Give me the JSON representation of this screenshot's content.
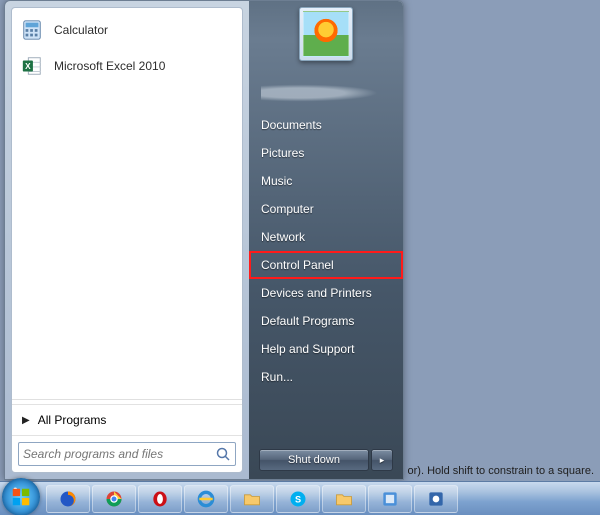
{
  "desktop": {
    "hint_text": "or). Hold shift to constrain to a square."
  },
  "start_menu": {
    "programs": [
      {
        "label": "Calculator",
        "icon": "calculator-icon"
      },
      {
        "label": "Microsoft Excel 2010",
        "icon": "excel-icon"
      }
    ],
    "all_programs_label": "All Programs",
    "search_placeholder": "Search programs and files",
    "right": {
      "user_name": "",
      "items": [
        {
          "label": "Documents",
          "highlighted": false
        },
        {
          "label": "Pictures",
          "highlighted": false
        },
        {
          "label": "Music",
          "highlighted": false
        },
        {
          "label": "Computer",
          "highlighted": false
        },
        {
          "label": "Network",
          "highlighted": false
        },
        {
          "label": "Control Panel",
          "highlighted": true
        },
        {
          "label": "Devices and Printers",
          "highlighted": false
        },
        {
          "label": "Default Programs",
          "highlighted": false
        },
        {
          "label": "Help and Support",
          "highlighted": false
        },
        {
          "label": "Run...",
          "highlighted": false
        }
      ],
      "shutdown_label": "Shut down"
    }
  },
  "taskbar": {
    "pinned": [
      {
        "name": "firefox-icon"
      },
      {
        "name": "chrome-icon"
      },
      {
        "name": "opera-icon"
      },
      {
        "name": "ie-icon"
      },
      {
        "name": "explorer-icon"
      },
      {
        "name": "skype-icon"
      },
      {
        "name": "folder-icon"
      },
      {
        "name": "app-icon"
      },
      {
        "name": "app2-icon"
      }
    ]
  },
  "colors": {
    "highlight": "#ff1a1a",
    "taskbar_top": "#c8d9ee",
    "taskbar_bottom": "#6a8fbf"
  }
}
